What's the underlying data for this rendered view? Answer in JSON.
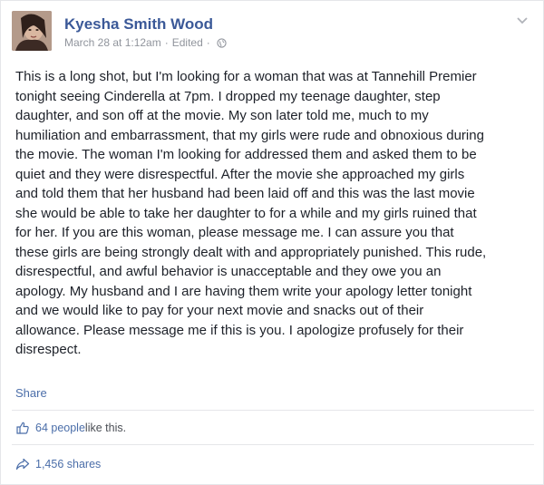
{
  "post": {
    "author": "Kyesha Smith Wood",
    "timestamp": "March 28 at 1:12am",
    "separator": "·",
    "edited_label": "Edited",
    "body": "This is a long shot, but I'm looking for a woman that was at Tannehill Premier\ntonight seeing Cinderella at 7pm. I dropped my teenage daughter, step\ndaughter, and son off at the movie. My son later told me, much to my\nhumiliation and embarrassment, that my girls were rude and obnoxious during\nthe movie. The woman I'm looking for addressed them and asked them to be\nquiet and they were disrespectful. After the movie she approached my girls\nand told them that her husband had been laid off and this was the last movie\nshe would be able to take her daughter to for a while and my girls ruined that\nfor her. If you are this woman, please message me. I can assure you that\nthese girls are being strongly dealt with and appropriately punished. This rude,\ndisrespectful, and awful behavior is unacceptable and they owe you an\napology. My husband and I are having them write your apology letter tonight\nand we would like to pay for your next movie and snacks out of their\nallowance. Please message me if this is you. I apologize profusely for their\ndisrespect.",
    "share_label": "Share"
  },
  "stats": {
    "likes_link": "64 people",
    "likes_suffix": " like this.",
    "shares": "1,456 shares"
  },
  "icons": {
    "audience": "globe-icon",
    "menu": "chevron-down-icon",
    "like": "thumbs-up-icon",
    "share": "share-arrow-icon"
  },
  "colors": {
    "author_name": "#3b5998",
    "link": "#4b6ea9",
    "meta": "#90949c",
    "body": "#1d2129"
  }
}
